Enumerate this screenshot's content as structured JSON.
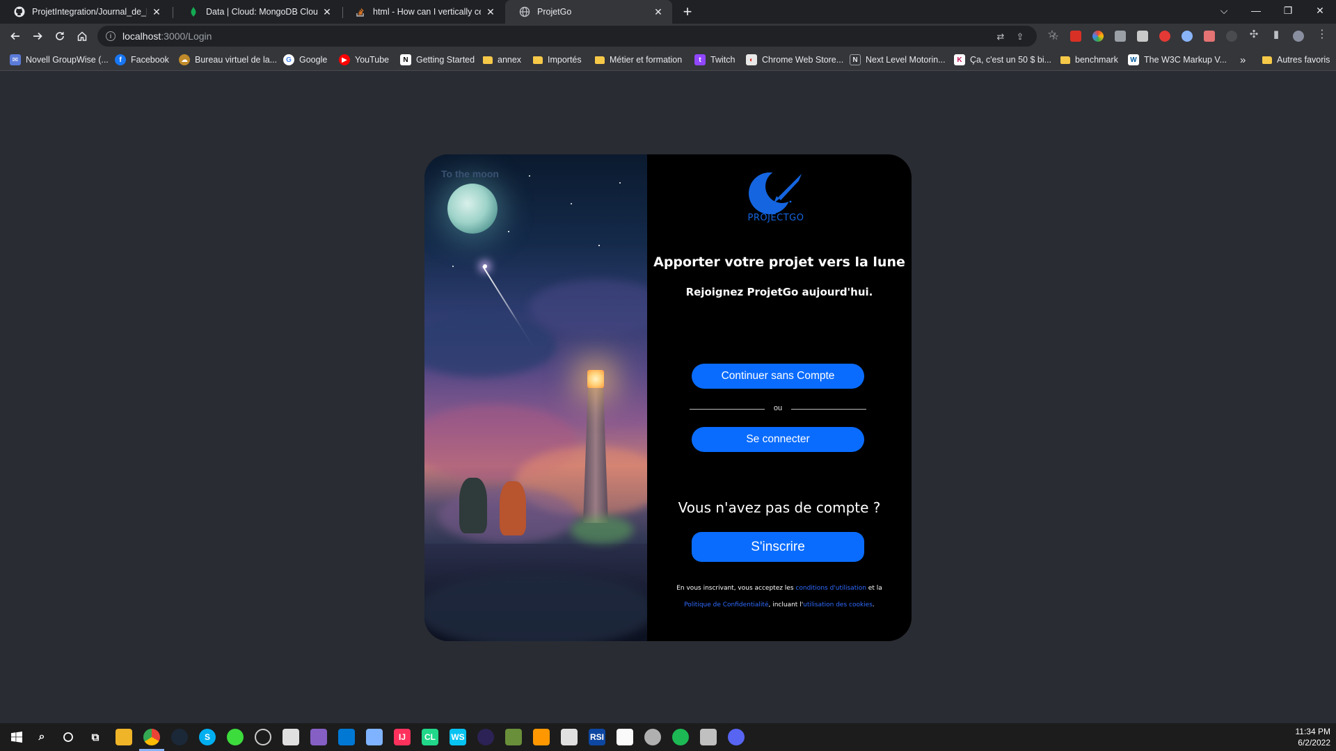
{
  "browser": {
    "tabs": [
      {
        "title": "ProjetIntegration/Journal_de_bor",
        "icon": "github-icon"
      },
      {
        "title": "Data | Cloud: MongoDB Cloud",
        "icon": "mongodb-icon"
      },
      {
        "title": "html - How can I vertically center",
        "icon": "stackoverflow-icon"
      },
      {
        "title": "ProjetGo",
        "icon": "globe-icon",
        "active": true
      }
    ],
    "url_host": "localhost",
    "url_path": ":3000/Login",
    "bookmarks": [
      {
        "label": "Novell GroupWise (...",
        "icon": "mail-icon"
      },
      {
        "label": "Facebook",
        "icon": "facebook-icon"
      },
      {
        "label": "Bureau virtuel de la...",
        "icon": "bureau-icon"
      },
      {
        "label": "Google",
        "icon": "google-icon"
      },
      {
        "label": "YouTube",
        "icon": "youtube-icon"
      },
      {
        "label": "Getting Started",
        "icon": "notion-icon"
      },
      {
        "label": "annex",
        "icon": "folder-icon"
      },
      {
        "label": "Importés",
        "icon": "folder-icon"
      },
      {
        "label": "Métier et formation",
        "icon": "folder-icon"
      },
      {
        "label": "Twitch",
        "icon": "twitch-icon"
      },
      {
        "label": "Chrome Web Store...",
        "icon": "webstore-icon"
      },
      {
        "label": "Next Level Motorin...",
        "icon": "nlm-icon"
      },
      {
        "label": "Ça, c'est un 50 $ bi...",
        "icon": "k-icon"
      },
      {
        "label": "benchmark",
        "icon": "folder-icon"
      },
      {
        "label": "The W3C Markup V...",
        "icon": "w3c-icon"
      }
    ],
    "more_bookmarks": "»",
    "other_bookmarks": "Autres favoris"
  },
  "login": {
    "art_caption": "To the moon",
    "logo_text": "PROJECTGO",
    "headline": "Apporter votre projet vers la lune",
    "subline": "Rejoignez ProjetGo aujourd'hui.",
    "guest_button": "Continuer sans Compte",
    "divider_text": "ou",
    "login_button": "Se connecter",
    "no_account": "Vous n'avez pas de compte ?",
    "signup_button": "S'inscrire",
    "legal": {
      "p1": "En vous inscrivant, vous acceptez les ",
      "terms": "conditions d'utilisation",
      "p2": " et la ",
      "privacy": "Politique de Confidentialité",
      "p3": ", incluant l'",
      "cookies": "utilisation des cookies",
      "p4": "."
    },
    "accent_color": "#0a6cff"
  },
  "taskbar": {
    "time": "11:34 PM",
    "date": "6/2/2022"
  }
}
